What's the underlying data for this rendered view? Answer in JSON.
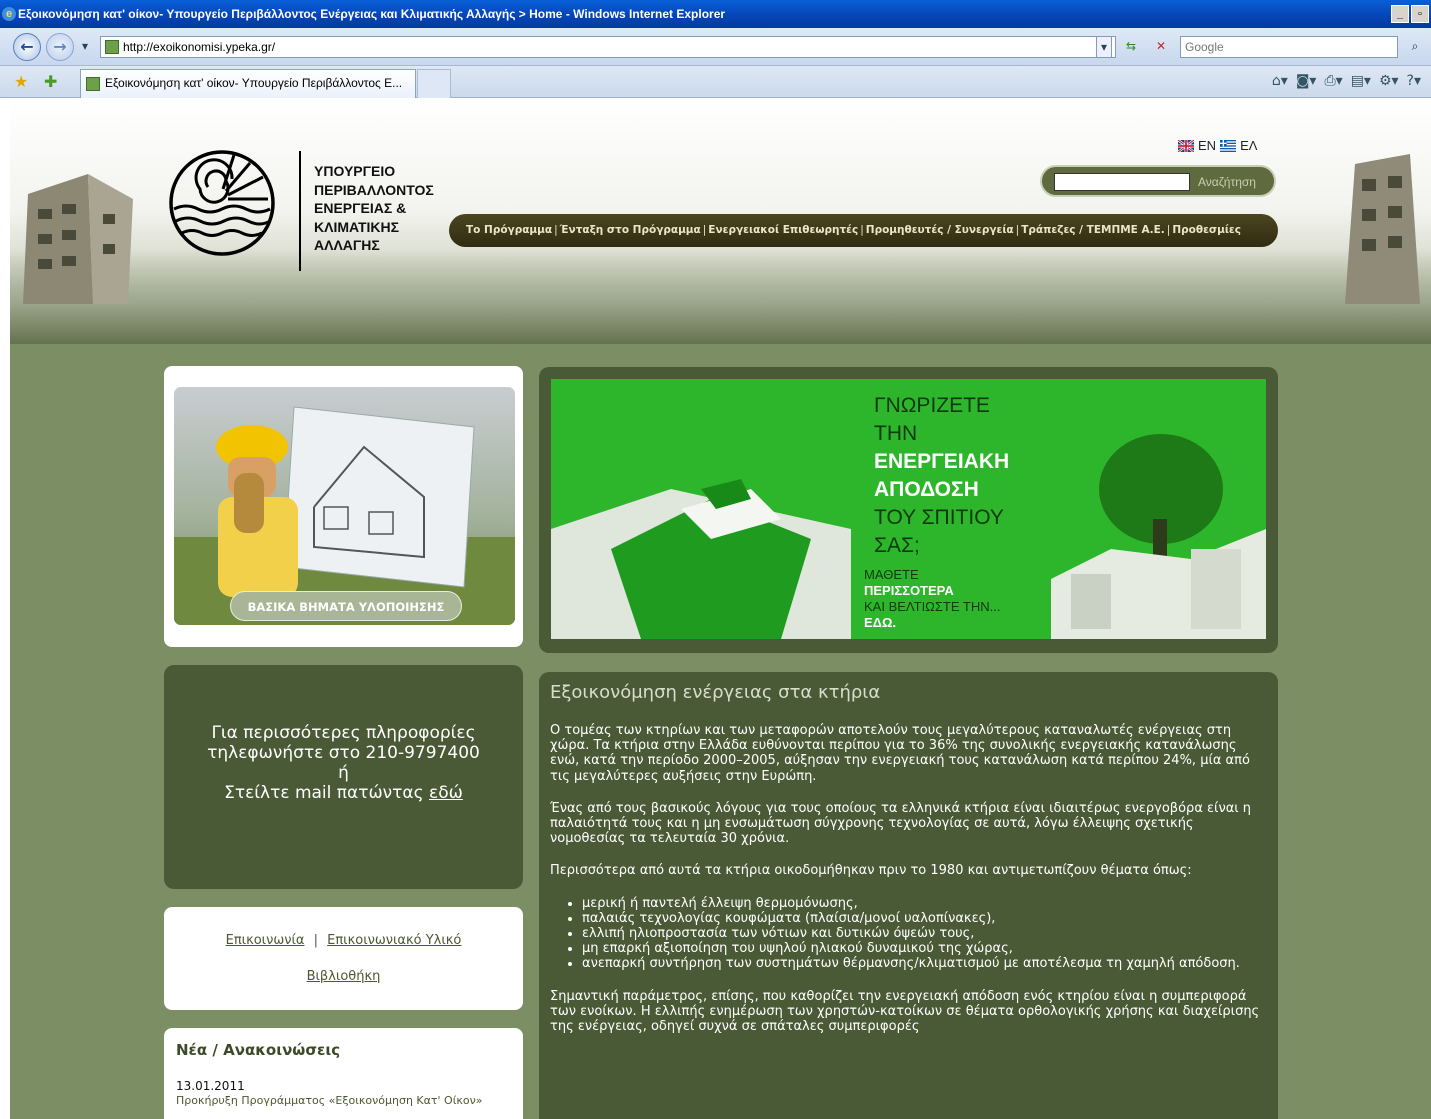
{
  "browser": {
    "title": "Εξοικονόμηση κατ' οίκον- Υπουργείο Περιβάλλοντος Ενέργειας και Κλιματικής Αλλαγής > Home - Windows Internet Explorer",
    "url": "http://exoikonomisi.ypeka.gr/",
    "search_placeholder": "Google",
    "tab_title": "Εξοικονόμηση κατ' οίκον- Υπουργείο Περιβάλλοντος Ε..."
  },
  "header": {
    "ministry_name": "ΥΠΟΥΡΓΕΙΟ\nΠΕΡΙΒΑΛΛΟΝΤΟΣ\nΕΝΕΡΓΕΙΑΣ &\nΚΛΙΜΑΤΙΚΗΣ\nΑΛΛΑΓΗΣ",
    "lang_en": "EN",
    "lang_el": "ΕΛ",
    "search_button": "Αναζήτηση"
  },
  "nav": {
    "items": [
      "Το Πρόγραμμα",
      "Ένταξη στο Πρόγραμμα",
      "Ενεργειακοί Επιθεωρητές",
      "Προμηθευτές / Συνεργεία",
      "Τράπεζες / ΤΕΜΠΜΕ Α.Ε.",
      "Προθεσμίες"
    ]
  },
  "promo": {
    "steps_button": "ΒΑΣΙΚΑ ΒΗΜΑΤΑ ΥΛΟΠΟΙΗΣΗΣ"
  },
  "banner": {
    "line1": "ΓΝΩΡΙΖΕΤΕ",
    "line2": "ΤΗΝ",
    "line3": "ΕΝΕΡΓΕΙΑΚΗ",
    "line4": "ΑΠΟΔΟΣΗ",
    "line5": "ΤΟΥ ΣΠΙΤΙΟΥ",
    "line6": "ΣΑΣ;",
    "sub1": "ΜΑΘΕΤΕ",
    "sub2": "ΠΕΡΙΣΣΟΤΕΡΑ",
    "sub3": "ΚΑΙ ΒΕΛΤΙΩΣΤΕ ΤΗΝ...",
    "sub4": "ΕΔΩ."
  },
  "contact": {
    "line1": "Για περισσότερες πληροφορίες",
    "line2": "τηλεφωνήστε στο 210-9797400",
    "line3": "ή",
    "line4": "Στείλτε mail πατώντας",
    "link": "εδώ"
  },
  "links": {
    "contact": "Επικοινωνία",
    "separator": "|",
    "material": "Επικοινωνιακό Υλικό",
    "library": "Βιβλιοθήκη"
  },
  "news": {
    "title": "Νέα / Ανακοινώσεις",
    "date": "13.01.2011",
    "item": "Προκήρυξη Προγράμματος «Εξοικονόμηση Κατ' Οίκον»"
  },
  "article": {
    "title": "Εξοικονόμηση ενέργειας στα κτήρια",
    "p1": "Ο τομέας των κτηρίων και των μεταφορών αποτελούν τους μεγαλύτερους καταναλωτές ενέργειας στη χώρα. Τα κτήρια στην Ελλάδα ευθύνονται περίπου για το 36% της συνολικής ενεργειακής κατανάλωσης ενώ, κατά την περίοδο 2000–2005, αύξησαν την ενεργειακή τους κατανάλωση κατά περίπου 24%, μία από τις μεγαλύτερες αυξήσεις στην Ευρώπη.",
    "p2": "Ένας από τους βασικούς λόγους για τους οποίους τα ελληνικά κτήρια είναι ιδιαιτέρως ενεργοβόρα είναι η παλαιότητά τους και η μη ενσωμάτωση σύγχρονης τεχνολογίας σε αυτά, λόγω έλλειψης σχετικής νομοθεσίας τα τελευταία 30 χρόνια.",
    "p3": "Περισσότερα από αυτά τα κτήρια οικοδομήθηκαν πριν το 1980 και αντιμετωπίζουν θέματα όπως:",
    "bullets": [
      "μερική ή παντελή έλλειψη θερμομόνωσης,",
      "παλαιάς τεχνολογίας κουφώματα (πλαίσια/μονοί υαλοπίνακες),",
      "ελλιπή ηλιοπροστασία των νότιων και δυτικών όψεών τους,",
      "μη επαρκή αξιοποίηση του υψηλού ηλιακού δυναμικού της χώρας,",
      "ανεπαρκή συντήρηση των συστημάτων θέρμανσης/κλιματισμού με αποτέλεσμα τη χαμηλή απόδοση."
    ],
    "p4": "Σημαντική παράμετρος, επίσης, που καθορίζει την ενεργειακή απόδοση ενός κτηρίου είναι η συμπεριφορά των ενοίκων. Η ελλιπής ενημέρωση των χρηστών-κατοίκων σε θέματα ορθολογικής χρήσης και διαχείρισης της ενέργειας, οδηγεί συχνά σε σπάταλες συμπεριφορές"
  }
}
